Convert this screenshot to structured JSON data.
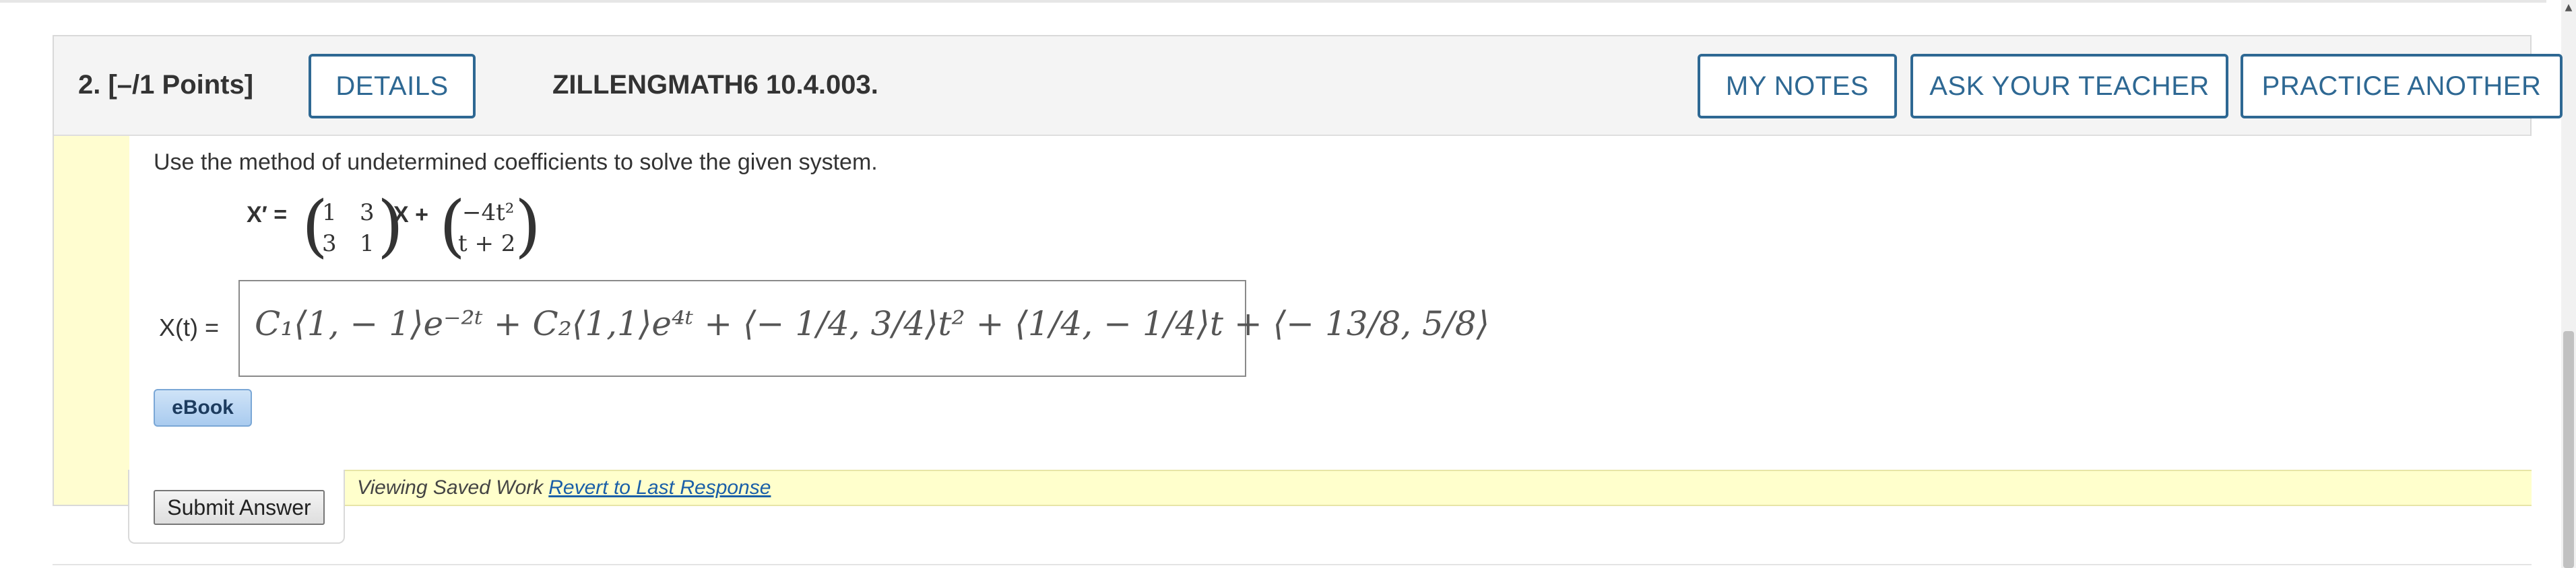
{
  "question": {
    "number_label": "2.  [–/1 Points]",
    "details_label": "DETAILS",
    "problem_code": "ZILLENGMATH6 10.4.003.",
    "my_notes_label": "MY NOTES",
    "ask_teacher_label": "ASK YOUR TEACHER",
    "practice_another_label": "PRACTICE ANOTHER"
  },
  "problem": {
    "instruction": "Use the method of undetermined coefficients to solve the given system.",
    "lhs": "X′ =",
    "matrix": [
      [
        "1",
        "3"
      ],
      [
        "3",
        "1"
      ]
    ],
    "x_plus": "X +",
    "forcing": [
      "−4t²",
      "t + 2"
    ]
  },
  "answer": {
    "label": "X(t) =",
    "value": "C₁⟨1, − 1⟩e⁻²ᵗ + C₂⟨1,1⟩e⁴ᵗ + ⟨− 1/4, 3/4⟩t² + ⟨1/4, − 1/4⟩t + ⟨− 13/8, 5/8⟩"
  },
  "ebook_label": "eBook",
  "submit_label": "Submit Answer",
  "saved_work": {
    "text": "Viewing Saved Work",
    "revert_link": "Revert to Last Response"
  },
  "colors": {
    "accent": "#2e6893",
    "highlight_red": "#cc0000",
    "saved_bar": "#ffffcc"
  }
}
